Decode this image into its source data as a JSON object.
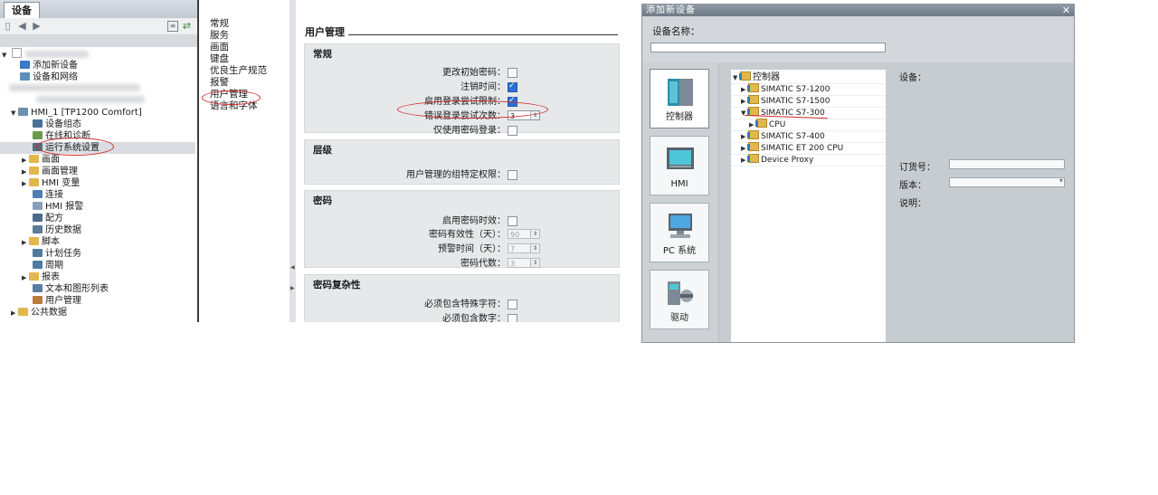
{
  "tree": {
    "tab_label": "设备",
    "items": [
      {
        "label": "添加新设备",
        "icon": "add-device-icon",
        "color": "#3a78c8"
      },
      {
        "label": "设备和网络",
        "icon": "network-icon",
        "color": "#5a8fc0"
      },
      {
        "label": "HMI_1 [TP1200 Comfort]",
        "icon": "hmi-icon",
        "color": "#6d8fb0"
      },
      {
        "label": "设备组态",
        "icon": "device-config-icon",
        "color": "#4b6f96"
      },
      {
        "label": "在线和诊断",
        "icon": "diagnostics-icon",
        "color": "#6b9a4e"
      },
      {
        "label": "运行系统设置",
        "icon": "runtime-settings-icon",
        "color": "#5a6a7a"
      },
      {
        "label": "画面",
        "icon": "folder-icon",
        "color": "#e2b84a"
      },
      {
        "label": "画面管理",
        "icon": "folder-icon",
        "color": "#e2b84a"
      },
      {
        "label": "HMI 变量",
        "icon": "folder-icon",
        "color": "#e2b84a"
      },
      {
        "label": "连接",
        "icon": "connection-icon",
        "color": "#4f7db0"
      },
      {
        "label": "HMI 报警",
        "icon": "alarm-icon",
        "color": "#8aa0b8"
      },
      {
        "label": "配方",
        "icon": "recipe-icon",
        "color": "#4e6a8a"
      },
      {
        "label": "历史数据",
        "icon": "history-icon",
        "color": "#5d7a96"
      },
      {
        "label": "脚本",
        "icon": "folder-icon",
        "color": "#e2b84a"
      },
      {
        "label": "计划任务",
        "icon": "scheduler-icon",
        "color": "#4e7aa0"
      },
      {
        "label": "周期",
        "icon": "cycle-icon",
        "color": "#4e7aa0"
      },
      {
        "label": "报表",
        "icon": "folder-icon",
        "color": "#e2b84a"
      },
      {
        "label": "文本和图形列表",
        "icon": "textlist-icon",
        "color": "#5b7d9f"
      },
      {
        "label": "用户管理",
        "icon": "users-icon",
        "color": "#b87b3a"
      },
      {
        "label": "公共数据",
        "icon": "folder-icon",
        "color": "#e2b84a"
      }
    ]
  },
  "nav": {
    "items": [
      "常规",
      "服务",
      "画面",
      "键盘",
      "优良生产规范",
      "报警",
      "用户管理",
      "语言和字体"
    ]
  },
  "settings": {
    "title": "用户管理",
    "groups": [
      {
        "title": "常规",
        "options": [
          {
            "label": "更改初始密码：",
            "type": "check",
            "checked": false
          },
          {
            "label": "注销时间：",
            "type": "check",
            "checked": true
          },
          {
            "label": "启用登录尝试限制：",
            "type": "check",
            "checked": true
          },
          {
            "label": "错误登录尝试次数：",
            "type": "spin",
            "value": "3",
            "disabled": false
          },
          {
            "label": "仅使用密码登录：",
            "type": "check",
            "checked": false
          }
        ]
      },
      {
        "title": "层级",
        "options": [
          {
            "label": "用户管理的组特定权限：",
            "type": "check",
            "checked": false
          }
        ]
      },
      {
        "title": "密码",
        "options": [
          {
            "label": "启用密码时效：",
            "type": "check",
            "checked": false
          },
          {
            "label": "密码有效性（天）：",
            "type": "spin",
            "value": "90",
            "disabled": true
          },
          {
            "label": "预警时间（天）：",
            "type": "spin",
            "value": "7",
            "disabled": true
          },
          {
            "label": "密码代数：",
            "type": "spin",
            "value": "3",
            "disabled": true
          }
        ]
      },
      {
        "title": "密码复杂性",
        "options": [
          {
            "label": "必须包含特殊字符：",
            "type": "check",
            "checked": false
          },
          {
            "label": "必须包含数字：",
            "type": "check",
            "checked": false
          }
        ]
      }
    ]
  },
  "dialog": {
    "title": "添加新设备",
    "close_icon": "close-icon",
    "name_label": "设备名称：",
    "name_value": "",
    "categories": [
      {
        "label": "控制器",
        "icon": "plc-icon"
      },
      {
        "label": "HMI",
        "icon": "hmi-panel-icon"
      },
      {
        "label": "PC 系统",
        "icon": "pc-icon"
      },
      {
        "label": "驱动",
        "icon": "drive-icon"
      }
    ],
    "tree": [
      {
        "label": "控制器",
        "level": 0,
        "state": "expanded"
      },
      {
        "label": "SIMATIC S7-1200",
        "level": 1,
        "state": "collapsed"
      },
      {
        "label": "SIMATIC S7-1500",
        "level": 1,
        "state": "collapsed"
      },
      {
        "label": "SIMATIC S7-300",
        "level": 1,
        "state": "expanded"
      },
      {
        "label": "CPU",
        "level": 2,
        "state": "collapsed"
      },
      {
        "label": "SIMATIC S7-400",
        "level": 1,
        "state": "collapsed"
      },
      {
        "label": "SIMATIC ET 200 CPU",
        "level": 1,
        "state": "collapsed"
      },
      {
        "label": "Device Proxy",
        "level": 1,
        "state": "collapsed"
      }
    ],
    "info": {
      "device_label": "设备：",
      "order_label": "订货号：",
      "version_label": "版本：",
      "description_label": "说明："
    }
  }
}
